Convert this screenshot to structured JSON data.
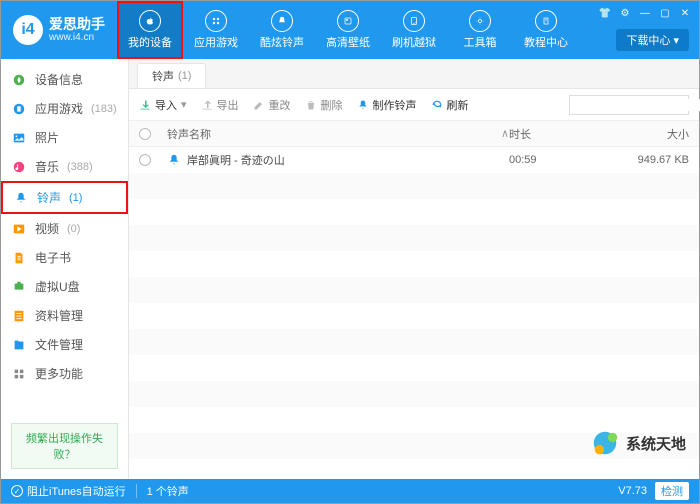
{
  "app": {
    "title": "爱思助手",
    "site": "www.i4.cn"
  },
  "window_controls": {
    "settings": "⚙",
    "skin": "👕",
    "min": "—",
    "max": "▢",
    "close": "✕"
  },
  "download_center": "下载中心 ▾",
  "nav": [
    {
      "id": "device",
      "label": "我的设备",
      "active": true,
      "highlight": true
    },
    {
      "id": "apps",
      "label": "应用游戏"
    },
    {
      "id": "ringtones",
      "label": "酷炫铃声"
    },
    {
      "id": "wallpapers",
      "label": "高清壁纸"
    },
    {
      "id": "jailbreak",
      "label": "刷机越狱"
    },
    {
      "id": "tools",
      "label": "工具箱"
    },
    {
      "id": "tutorial",
      "label": "教程中心"
    }
  ],
  "sidebar": {
    "items": [
      {
        "label": "设备信息",
        "color": "#4caf50"
      },
      {
        "label": "应用游戏",
        "count": "(183)",
        "color": "#1f98ed"
      },
      {
        "label": "照片",
        "color": "#1f98ed"
      },
      {
        "label": "音乐",
        "count": "(388)",
        "color": "#ff4081"
      },
      {
        "label": "铃声",
        "count": "(1)",
        "color": "#1f98ed",
        "active": true,
        "highlight": true
      },
      {
        "label": "视频",
        "count": "(0)",
        "color": "#ff9800"
      },
      {
        "label": "电子书",
        "color": "#ff9800"
      },
      {
        "label": "虚拟U盘",
        "color": "#4caf50"
      },
      {
        "label": "资料管理",
        "color": "#ff9800"
      },
      {
        "label": "文件管理",
        "color": "#1f98ed"
      },
      {
        "label": "更多功能",
        "color": "#888"
      }
    ],
    "foot_link": "频繁出现操作失败？"
  },
  "tab": {
    "label": "铃声",
    "count": "(1)"
  },
  "toolbar": {
    "import": "导入",
    "export": "导出",
    "rename": "重改",
    "delete": "删除",
    "make": "制作铃声",
    "refresh": "刷新",
    "search_placeholder": ""
  },
  "table": {
    "headers": {
      "name": "铃声名称",
      "duration": "时长",
      "size": "大小",
      "sort": "∧"
    },
    "rows": [
      {
        "name": "岸部眞明 - 奇迹の山",
        "duration": "00:59",
        "size": "949.67 KB"
      }
    ],
    "empty_rows": 12
  },
  "statusbar": {
    "itunes": "阻止iTunes自动运行",
    "count": "1 个铃声",
    "version": "V7.73",
    "check": "检测"
  },
  "watermark": "系统天地"
}
